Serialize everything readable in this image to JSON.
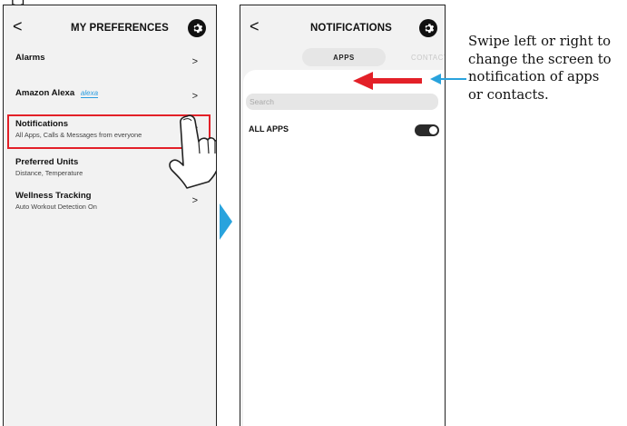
{
  "top_crop_text": "[                              ]",
  "screen1": {
    "back_icon": "chevron-left-icon",
    "title": "MY PREFERENCES",
    "settings_icon": "gear-icon",
    "rows": [
      {
        "title": "Alarms",
        "subtitle": ""
      },
      {
        "title": "Amazon Alexa",
        "subtitle": "",
        "logo_text": "alexa"
      },
      {
        "title": "Notifications",
        "subtitle": "All Apps, Calls & Messages from everyone",
        "highlighted": true
      },
      {
        "title": "Preferred Units",
        "subtitle": "Distance, Temperature"
      },
      {
        "title": "Wellness Tracking",
        "subtitle": "Auto Workout Detection On"
      }
    ],
    "chevron": ">"
  },
  "screen2": {
    "back_icon": "chevron-left-icon",
    "title": "NOTIFICATIONS",
    "settings_icon": "gear-icon",
    "tabs": [
      "APPS",
      "CONTACTS"
    ],
    "active_tab": "APPS",
    "search_placeholder": "Search",
    "all_apps_label": "ALL APPS",
    "all_apps_toggle_on": true
  },
  "caption_lines": [
    "Swipe left or right to",
    "change the screen to",
    "notification of apps",
    "or contacts."
  ],
  "colors": {
    "highlight": "#e32028",
    "arrow_red": "#e32028",
    "arrow_blue": "#29a3dd",
    "screen_bg": "#f2f2f2",
    "toggle_on": "#2a2a2a"
  }
}
